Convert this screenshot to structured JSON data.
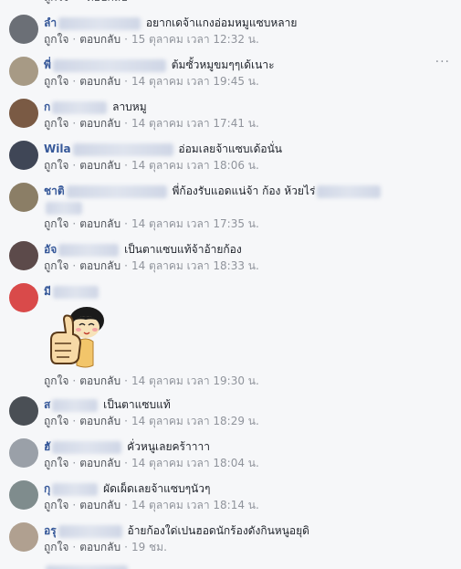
{
  "labels": {
    "like": "ถูกใจ",
    "reply": "ตอบกลับ",
    "sep": "·",
    "more": "···"
  },
  "comments": [
    {
      "name": "ลำ",
      "text": "อยากเดจ้าแกงอ่อมหมูแซบหลาย",
      "time": "15 ตุลาคม เวลา 12:32 น.",
      "avatar_color": "#6b6f76"
    },
    {
      "name": "พี่",
      "text": "ต้มซั้วหมูขมๆๆเด้เนาะ",
      "time": "14 ตุลาคม เวลา 19:45 น.",
      "avatar_color": "#a79a85"
    },
    {
      "name": "ก",
      "text": "ลาบหมู",
      "time": "14 ตุลาคม เวลา 17:41 น.",
      "avatar_color": "#7a5a44"
    },
    {
      "name": "Wila",
      "text": "อ่อมเลยจ้าแซบเด้อนั่น",
      "time": "14 ตุลาคม เวลา 18:06 น.",
      "avatar_color": "#3f4656"
    },
    {
      "name": "ชาติ",
      "text": "พี่ก้องรับแอดแน่จ้า ก้อง ห้วยไร่",
      "time": "14 ตุลาคม เวลา 17:35 น.",
      "avatar_color": "#8b7e66"
    },
    {
      "name": "อัจ",
      "text": "เป็นตาแซบแท้จ้าอ้ายก้อง",
      "time": "14 ตุลาคม เวลา 18:33 น.",
      "avatar_color": "#5c4a4a"
    },
    {
      "name": "มี",
      "text": "",
      "time": "14 ตุลาคม เวลา 19:30 น.",
      "avatar_color": "#d94a4a"
    },
    {
      "name": "ส",
      "text": "เป็นตาแซบแท้",
      "time": "14 ตุลาคม เวลา 18:29 น.",
      "avatar_color": "#4a4f55"
    },
    {
      "name": "ฮั",
      "text": "คั่วหนูเลยคร้าาาา",
      "time": "14 ตุลาคม เวลา 18:04 น.",
      "avatar_color": "#9aa0a8"
    },
    {
      "name": "กุ",
      "text": "ผัดเผ็ดเลยจ้าแซบๆนัวๆ",
      "time": "14 ตุลาคม เวลา 18:14 น.",
      "avatar_color": "#7f8c8d"
    },
    {
      "name": "อรุ",
      "text": "อ้ายก้องใด่เปนฮอดนักร้องดังกินหนูอยุดิ",
      "time": "19 ชม.",
      "avatar_color": "#b0a090"
    }
  ]
}
